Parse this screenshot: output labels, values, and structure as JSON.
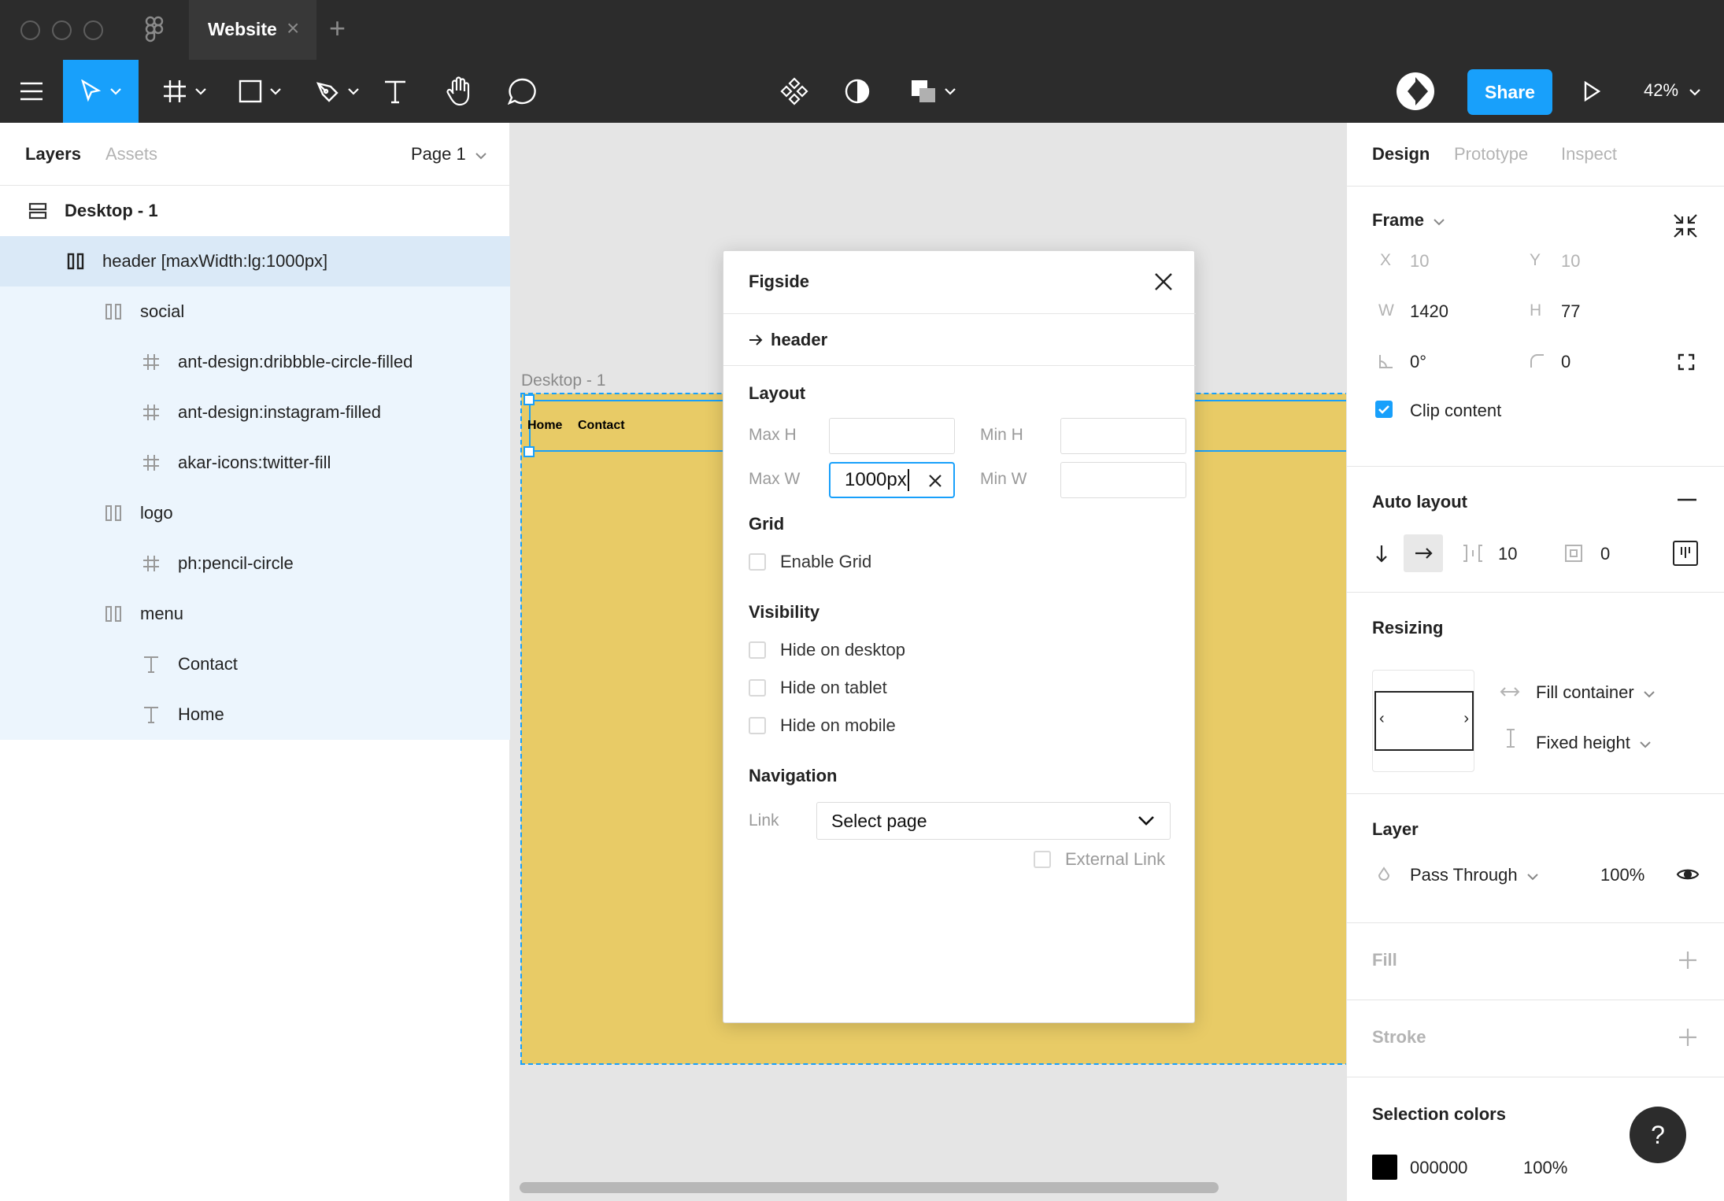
{
  "titlebar": {
    "tab_title": "Website",
    "tab_close": "×",
    "tab_add": "+"
  },
  "toolbar": {
    "share_label": "Share",
    "zoom": "42%"
  },
  "left_panel": {
    "tabs": [
      "Layers",
      "Assets"
    ],
    "page_select": "Page 1",
    "layers": [
      {
        "label": "Desktop - 1",
        "icon": "frame-stack-icon"
      },
      {
        "label": "header [maxWidth:lg:1000px]",
        "icon": "auto-layout-icon"
      },
      {
        "label": "social",
        "icon": "auto-layout-icon"
      },
      {
        "label": "ant-design:dribbble-circle-filled",
        "icon": "frame-hash-icon"
      },
      {
        "label": "ant-design:instagram-filled",
        "icon": "frame-hash-icon"
      },
      {
        "label": "akar-icons:twitter-fill",
        "icon": "frame-hash-icon"
      },
      {
        "label": "logo",
        "icon": "auto-layout-icon"
      },
      {
        "label": "ph:pencil-circle",
        "icon": "frame-hash-icon"
      },
      {
        "label": "menu",
        "icon": "auto-layout-icon"
      },
      {
        "label": "Contact",
        "icon": "text-layer-icon"
      },
      {
        "label": "Home",
        "icon": "text-layer-icon"
      }
    ]
  },
  "canvas": {
    "frame_label": "Desktop - 1",
    "nav_home": "Home",
    "nav_contact": "Contact",
    "frame_color": "#e8cb66",
    "selection_color": "#18a0fb"
  },
  "plugin": {
    "title": "Figside",
    "node": "header",
    "layout_title": "Layout",
    "max_h_label": "Max H",
    "min_h_label": "Min H",
    "max_w_label": "Max W",
    "min_w_label": "Min W",
    "max_w_value": "1000px",
    "grid_title": "Grid",
    "enable_grid": "Enable Grid",
    "visibility_title": "Visibility",
    "hide_desktop": "Hide on desktop",
    "hide_tablet": "Hide on tablet",
    "hide_mobile": "Hide on mobile",
    "navigation_title": "Navigation",
    "link_label": "Link",
    "link_select": "Select page",
    "external_link": "External Link"
  },
  "right_panel": {
    "tabs": [
      "Design",
      "Prototype",
      "Inspect"
    ],
    "frame": {
      "title": "Frame",
      "x_label": "X",
      "x": "10",
      "y_label": "Y",
      "y": "10",
      "w_label": "W",
      "w": "1420",
      "h_label": "H",
      "h": "77",
      "rotation": "0°",
      "radius": "0",
      "clip_content": "Clip content"
    },
    "auto_layout": {
      "title": "Auto layout",
      "spacing": "10",
      "padding": "0"
    },
    "resizing": {
      "title": "Resizing",
      "horizontal": "Fill container",
      "vertical": "Fixed height"
    },
    "layer": {
      "title": "Layer",
      "blend": "Pass Through",
      "opacity": "100%"
    },
    "fill": {
      "title": "Fill"
    },
    "stroke": {
      "title": "Stroke"
    },
    "selection_colors": {
      "title": "Selection colors",
      "hex": "000000",
      "opacity": "100%",
      "swatch": "#000000"
    },
    "help": "?"
  },
  "colors": {
    "accent": "#18a0fb",
    "chrome": "#2c2c2c"
  }
}
